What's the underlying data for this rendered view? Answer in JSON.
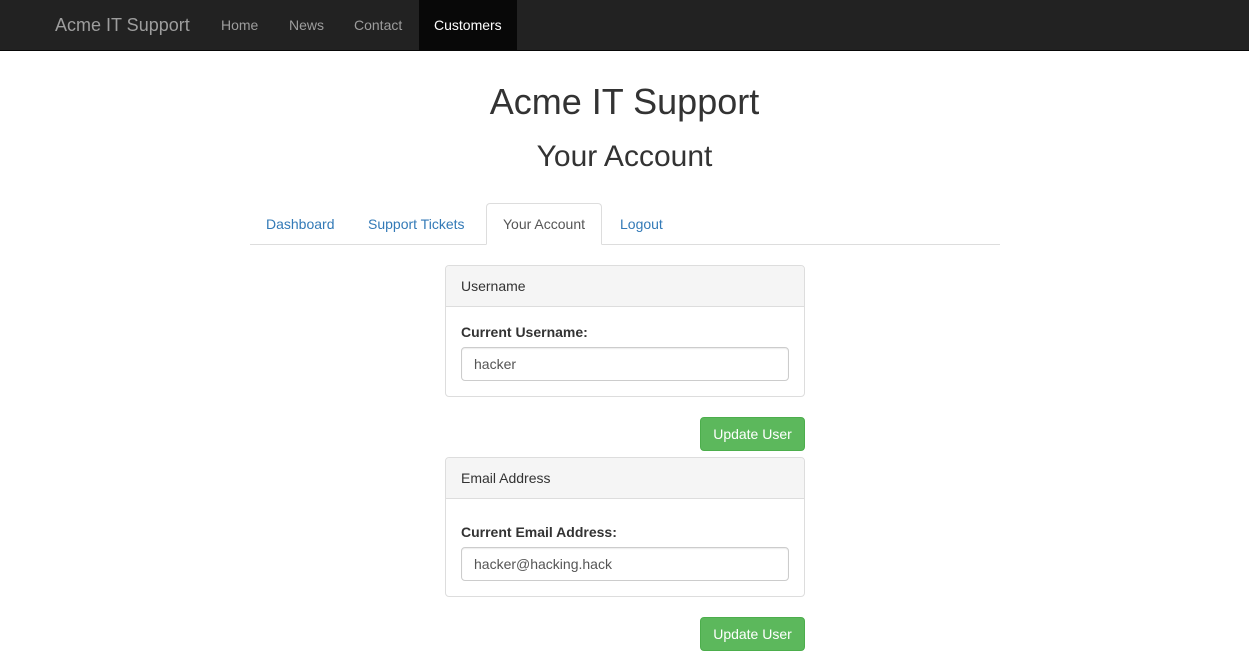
{
  "navbar": {
    "brand": "Acme IT Support",
    "links": [
      {
        "label": "Home"
      },
      {
        "label": "News"
      },
      {
        "label": "Contact"
      },
      {
        "label": "Customers",
        "active": true
      }
    ]
  },
  "page": {
    "title": "Acme IT Support",
    "subtitle": "Your Account"
  },
  "tabs": [
    {
      "label": "Dashboard"
    },
    {
      "label": "Support Tickets"
    },
    {
      "label": "Your Account",
      "active": true
    },
    {
      "label": "Logout"
    }
  ],
  "username_panel": {
    "heading": "Username",
    "field_label": "Current Username:",
    "value": "hacker",
    "button_label": "Update User"
  },
  "email_panel": {
    "heading": "Email Address",
    "field_label": "Current Email Address:",
    "value": "hacker@hacking.hack",
    "button_label": "Update User"
  },
  "colors": {
    "navbar_bg": "#222222",
    "link": "#337ab7",
    "success": "#5cb85c"
  }
}
